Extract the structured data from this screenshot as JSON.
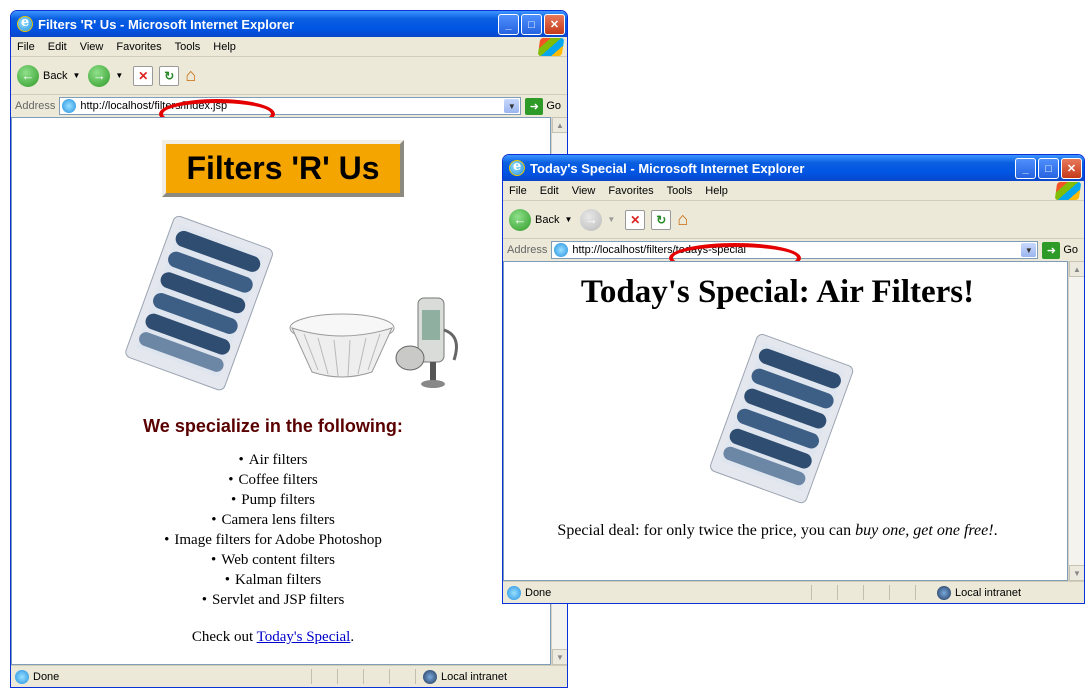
{
  "window1": {
    "title": "Filters 'R' Us - Microsoft Internet Explorer",
    "menu": [
      "File",
      "Edit",
      "View",
      "Favorites",
      "Tools",
      "Help"
    ],
    "back_label": "Back",
    "address_label": "Address",
    "url": "http://localhost/filters/index.jsp",
    "go_label": "Go",
    "logo_text": "Filters 'R' Us",
    "heading": "We specialize in the following:",
    "items": [
      "Air filters",
      "Coffee filters",
      "Pump filters",
      "Camera lens filters",
      "Image filters for Adobe Photoshop",
      "Web content filters",
      "Kalman filters",
      "Servlet and JSP filters"
    ],
    "checkout_prefix": "Check out",
    "checkout_link": "Today's Special",
    "checkout_suffix": ".",
    "status": "Done",
    "zone": "Local intranet"
  },
  "window2": {
    "title": "Today's Special - Microsoft Internet Explorer",
    "menu": [
      "File",
      "Edit",
      "View",
      "Favorites",
      "Tools",
      "Help"
    ],
    "back_label": "Back",
    "address_label": "Address",
    "url": "http://localhost/filters/todays-special",
    "go_label": "Go",
    "heading": "Today's Special: Air Filters!",
    "deal_prefix": "Special deal: for only twice the price, you can",
    "deal_emphasis": "buy one, get one free!",
    "deal_suffix": ".",
    "status": "Done",
    "zone": "Local intranet"
  },
  "colors": {
    "titlebar": "#0054e3",
    "logo_bg": "#f5a500",
    "heading_color": "#5a0000",
    "link_color": "#0000cc",
    "highlight_oval": "#e50000"
  }
}
